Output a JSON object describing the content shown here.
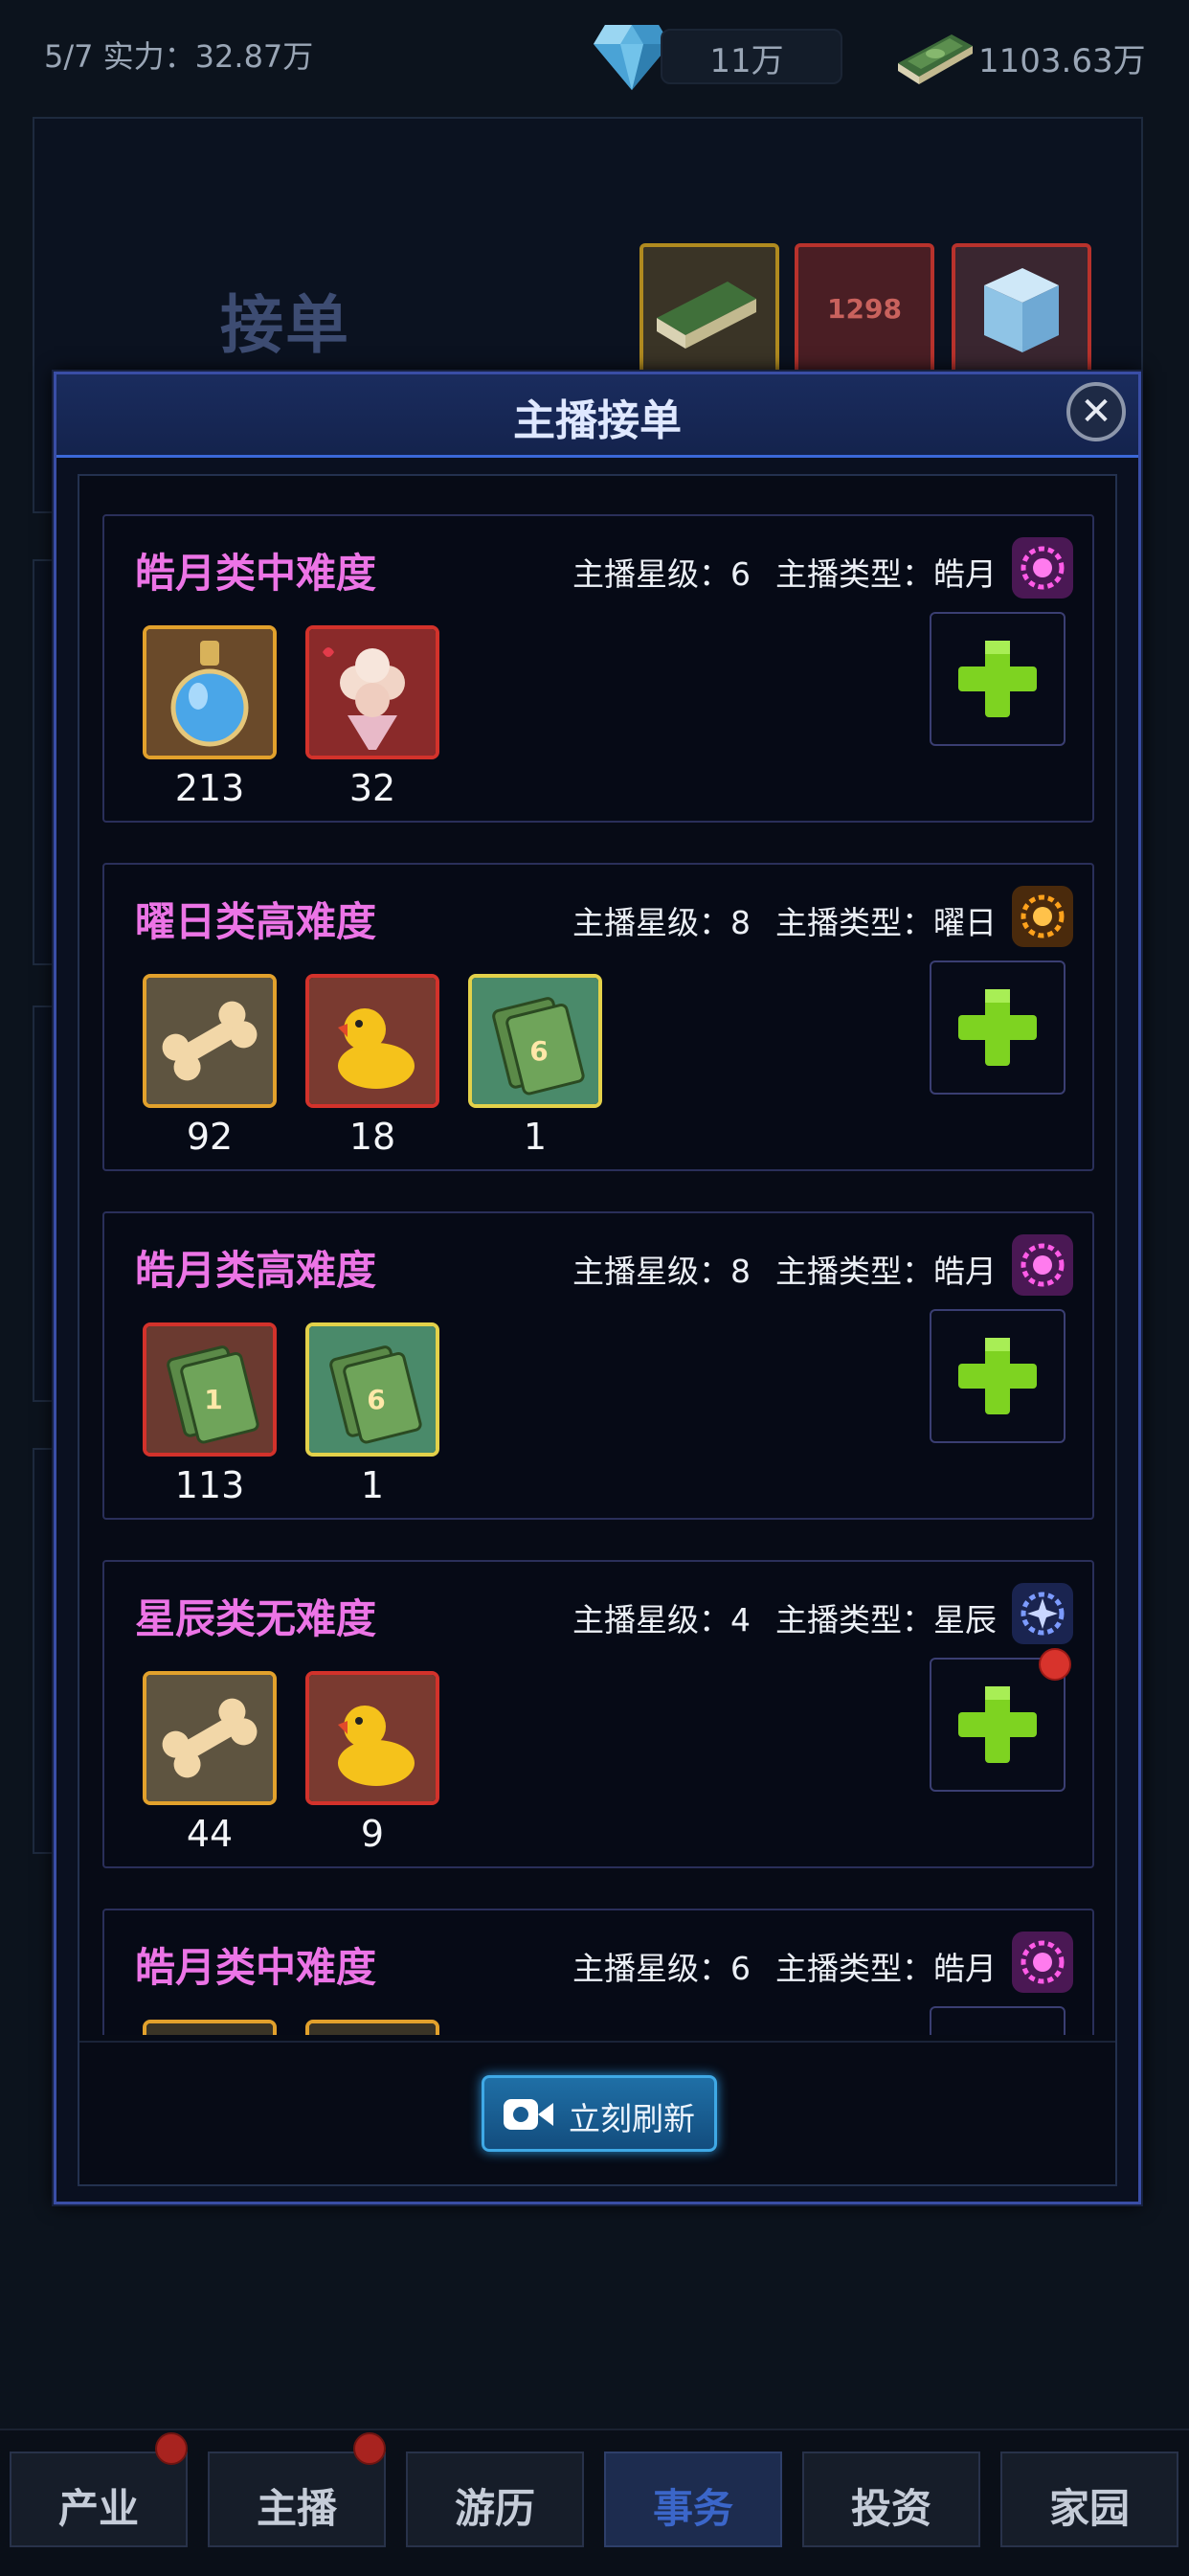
{
  "topbar": {
    "level": "5/7  实力：32.87万",
    "gems": "11万",
    "cash": "1103.63万"
  },
  "background": {
    "title": "接单",
    "item_label": "1298"
  },
  "dialog": {
    "title": "主播接单",
    "close_icon": "close-icon",
    "refresh_label": "立刻刷新",
    "orders": [
      {
        "title": "皓月类中难度",
        "star_label": "主播星级：",
        "star": "6",
        "type_label": "主播类型：",
        "type": "皓月",
        "type_icon": "moon-gear-icon",
        "badge": false,
        "items": [
          {
            "icon": "potion-icon",
            "qty": "213"
          },
          {
            "icon": "rose-bouquet-icon",
            "qty": "32"
          }
        ]
      },
      {
        "title": "曜日类高难度",
        "star_label": "主播星级：",
        "star": "8",
        "type_label": "主播类型：",
        "type": "曜日",
        "type_icon": "sun-gear-icon",
        "badge": false,
        "items": [
          {
            "icon": "bone-icon",
            "qty": "92"
          },
          {
            "icon": "rubber-duck-icon",
            "qty": "18"
          },
          {
            "icon": "card-6-icon",
            "card": "6",
            "qty": "1"
          }
        ]
      },
      {
        "title": "皓月类高难度",
        "star_label": "主播星级：",
        "star": "8",
        "type_label": "主播类型：",
        "type": "皓月",
        "type_icon": "moon-gear-icon",
        "badge": false,
        "items": [
          {
            "icon": "card-1-icon",
            "card": "1",
            "qty": "113"
          },
          {
            "icon": "card-6-icon",
            "card": "6",
            "qty": "1"
          }
        ]
      },
      {
        "title": "星辰类无难度",
        "star_label": "主播星级：",
        "star": "4",
        "type_label": "主播类型：",
        "type": "星辰",
        "type_icon": "star-gear-icon",
        "badge": true,
        "items": [
          {
            "icon": "bone-icon",
            "qty": "44"
          },
          {
            "icon": "rubber-duck-icon",
            "qty": "9"
          }
        ]
      },
      {
        "title": "皓月类中难度",
        "star_label": "主播星级：",
        "star": "6",
        "type_label": "主播类型：",
        "type": "皓月",
        "type_icon": "moon-gear-icon",
        "badge": false,
        "items": [
          {
            "icon": "item-icon",
            "qty": ""
          },
          {
            "icon": "item-icon",
            "qty": ""
          }
        ]
      }
    ]
  },
  "nav": {
    "tabs": [
      {
        "label": "产业",
        "badge": true,
        "active": false
      },
      {
        "label": "主播",
        "badge": true,
        "active": false
      },
      {
        "label": "游历",
        "badge": false,
        "active": false
      },
      {
        "label": "事务",
        "badge": false,
        "active": true
      },
      {
        "label": "投资",
        "badge": false,
        "active": false
      },
      {
        "label": "家园",
        "badge": false,
        "active": false
      }
    ]
  },
  "colors": {
    "order_title": "#ec74e6",
    "plus": "#7ed321",
    "accent_blue": "#3b68d8",
    "active_tab_text": "#3b66c9"
  }
}
